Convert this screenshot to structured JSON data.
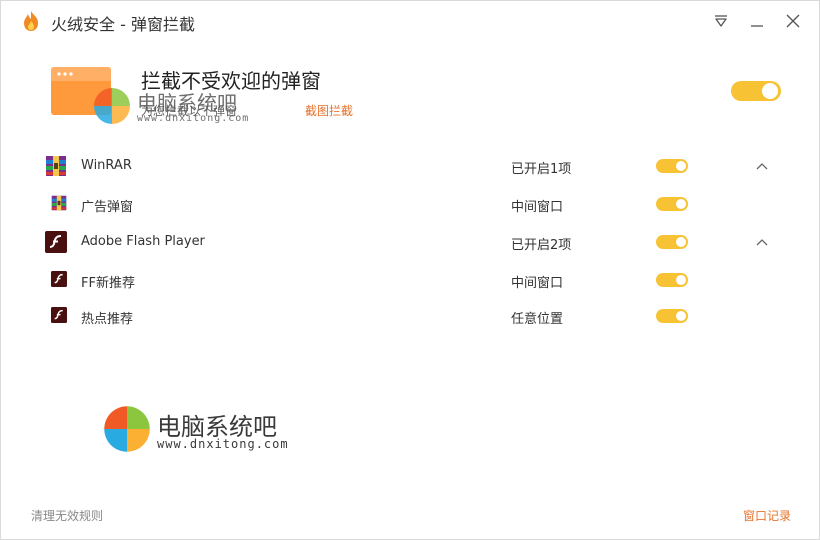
{
  "titlebar": {
    "title": "火绒安全 - 弹窗拦截",
    "logo_icon": "fire-logo-icon",
    "menu_icon": "menu-dropdown-icon",
    "minimize_icon": "minimize-icon",
    "close_icon": "close-icon"
  },
  "header": {
    "title": "拦截不受欢迎的弹窗",
    "description": "为您拦截以下弹窗",
    "link": "截图拦截",
    "master_toggle_on": true
  },
  "apps": [
    {
      "name": "WinRAR",
      "status": "已开启1项",
      "icon": "winrar-icon",
      "enabled": true,
      "expanded": true
    },
    {
      "name": "广告弹窗",
      "status": "中间窗口",
      "icon": "winrar-icon",
      "enabled": true,
      "child": true
    },
    {
      "name": "Adobe Flash Player",
      "status": "已开启2项",
      "icon": "flash-icon",
      "enabled": true,
      "expanded": true
    },
    {
      "name": "FF新推荐",
      "status": "中间窗口",
      "icon": "flash-icon",
      "enabled": true,
      "child": true
    },
    {
      "name": "热点推荐",
      "status": "任意位置",
      "icon": "flash-icon",
      "enabled": true,
      "child": true
    }
  ],
  "footer": {
    "left_link": "清理无效规则",
    "right_link": "窗口记录"
  },
  "watermark": {
    "text": "电脑系统吧",
    "url": "www.dnxitong.com"
  },
  "colors": {
    "accent_orange": "#e8732c",
    "toggle_yellow": "#f7c233",
    "hero_icon_orange": "#ff9a3c"
  }
}
